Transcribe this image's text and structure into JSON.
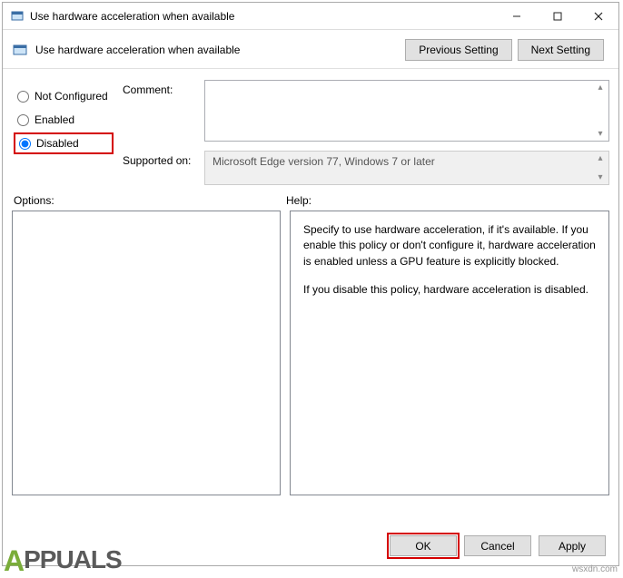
{
  "window": {
    "title": "Use hardware acceleration when available"
  },
  "header": {
    "title": "Use hardware acceleration when available",
    "prev_button": "Previous Setting",
    "next_button": "Next Setting"
  },
  "radios": {
    "not_configured": "Not Configured",
    "enabled": "Enabled",
    "disabled": "Disabled",
    "selected": "disabled"
  },
  "fields": {
    "comment_label": "Comment:",
    "comment_value": "",
    "supported_label": "Supported on:",
    "supported_value": "Microsoft Edge version 77, Windows 7 or later"
  },
  "labels": {
    "options": "Options:",
    "help": "Help:"
  },
  "help": {
    "p1": "Specify to use hardware acceleration, if it's available. If you enable this policy or don't configure it, hardware acceleration is enabled unless a GPU feature is explicitly blocked.",
    "p2": "If you disable this policy, hardware acceleration is disabled."
  },
  "buttons": {
    "ok": "OK",
    "cancel": "Cancel",
    "apply": "Apply"
  },
  "watermark": "wsxdn.com",
  "logo": "PPUALS"
}
